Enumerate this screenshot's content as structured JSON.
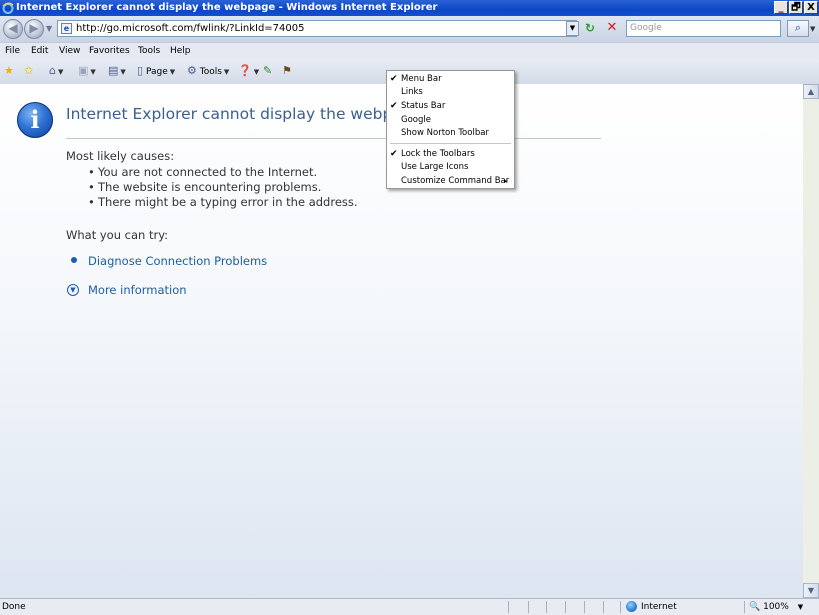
{
  "window": {
    "title": "Internet Explorer cannot display the webpage - Windows Internet Explorer",
    "buttons": [
      "_",
      "🗗",
      "X"
    ]
  },
  "address_bar": {
    "url": "http://go.microsoft.com/fwlink/?LinkId=74005",
    "page_icon": "e"
  },
  "search": {
    "placeholder": "Google"
  },
  "menu": {
    "items": [
      "File",
      "Edit",
      "View",
      "Favorites",
      "Tools",
      "Help"
    ]
  },
  "command_bar": {
    "page_label": "Page",
    "tools_label": "Tools"
  },
  "content": {
    "title": "Internet Explorer cannot display the webpage",
    "causes_heading": "Most likely causes:",
    "causes": [
      "You are not connected to the Internet.",
      "The website is encountering problems.",
      "There might be a typing error in the address."
    ],
    "try_heading": "What you can try:",
    "diagnose_link": "Diagnose Connection Problems",
    "more_info_link": "More information"
  },
  "context_menu": {
    "items": [
      {
        "label": "Menu Bar",
        "checked": "✔"
      },
      {
        "label": "Links",
        "checked": ""
      },
      {
        "label": "Status Bar",
        "checked": "✔"
      },
      {
        "label": "Google",
        "checked": ""
      },
      {
        "label": "Show Norton Toolbar",
        "checked": ""
      },
      {
        "label": "Lock the Toolbars",
        "checked": "✔"
      },
      {
        "label": "Use Large Icons",
        "checked": ""
      },
      {
        "label": "Customize Command Bar",
        "checked": "",
        "submenu": "▸"
      }
    ]
  },
  "status": {
    "text": "Done",
    "zone": "Internet",
    "zoom": "100%"
  },
  "colors": {
    "title_text": "#3b5f8f",
    "link": "#1f5d9e",
    "titlebar": "#0c47c5"
  }
}
